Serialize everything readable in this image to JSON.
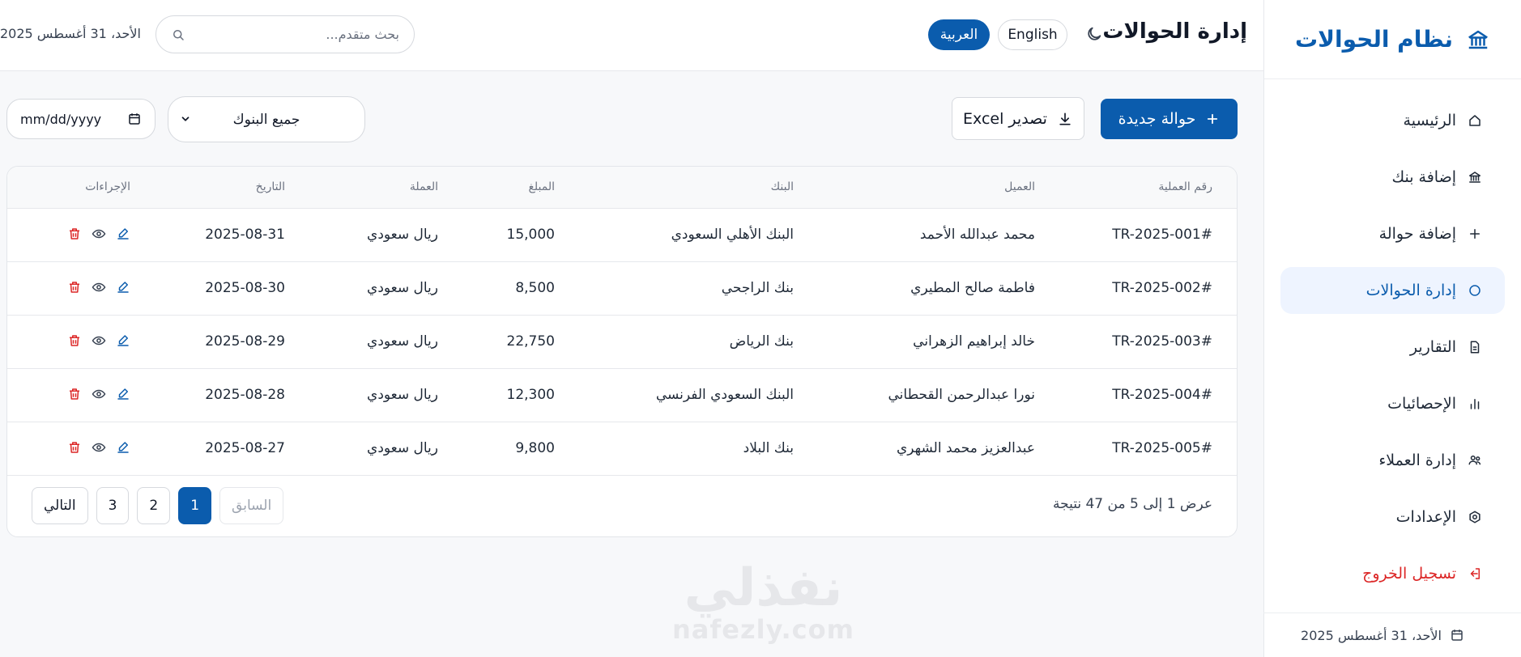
{
  "brand": {
    "title": "نظام الحوالات",
    "icon": "bank-icon"
  },
  "sidebar": {
    "items": [
      {
        "label": "الرئيسية",
        "icon": "home-icon"
      },
      {
        "label": "إضافة بنك",
        "icon": "bank-icon"
      },
      {
        "label": "إضافة حوالة",
        "icon": "plus-icon"
      },
      {
        "label": "إدارة الحوالات",
        "icon": "circle-icon",
        "active": true
      },
      {
        "label": "التقارير",
        "icon": "document-icon"
      },
      {
        "label": "الإحصائيات",
        "icon": "bar-chart-icon"
      },
      {
        "label": "إدارة العملاء",
        "icon": "users-icon"
      },
      {
        "label": "الإعدادات",
        "icon": "settings-icon"
      },
      {
        "label": "تسجيل الخروج",
        "icon": "logout-icon"
      }
    ],
    "footer_date": "الأحد، 31 أغسطس 2025"
  },
  "header": {
    "title": "إدارة الحوالات",
    "lang_en": "English",
    "lang_ar": "العربية",
    "search_placeholder": "بحث متقدم...",
    "date": "الأحد، 31 أغسطس 2025"
  },
  "toolbar": {
    "new_transfer": "حوالة جديدة",
    "export": "تصدير Excel",
    "bank_filter": "جميع البنوك",
    "date_placeholder": "mm/dd/yyyy"
  },
  "table": {
    "columns": [
      "رقم العملية",
      "العميل",
      "البنك",
      "المبلغ",
      "العملة",
      "التاريخ",
      "الإجراءات"
    ],
    "rows": [
      {
        "id": "#TR-2025-001",
        "client": "محمد عبدالله الأحمد",
        "bank": "البنك الأهلي السعودي",
        "amount": "15,000",
        "currency": "ريال سعودي",
        "date": "2025-08-31"
      },
      {
        "id": "#TR-2025-002",
        "client": "فاطمة صالح المطيري",
        "bank": "بنك الراجحي",
        "amount": "8,500",
        "currency": "ريال سعودي",
        "date": "2025-08-30"
      },
      {
        "id": "#TR-2025-003",
        "client": "خالد إبراهيم الزهراني",
        "bank": "بنك الرياض",
        "amount": "22,750",
        "currency": "ريال سعودي",
        "date": "2025-08-29"
      },
      {
        "id": "#TR-2025-004",
        "client": "نورا عبدالرحمن القحطاني",
        "bank": "البنك السعودي الفرنسي",
        "amount": "12,300",
        "currency": "ريال سعودي",
        "date": "2025-08-28"
      },
      {
        "id": "#TR-2025-005",
        "client": "عبدالعزيز محمد الشهري",
        "bank": "بنك البلاد",
        "amount": "9,800",
        "currency": "ريال سعودي",
        "date": "2025-08-27"
      }
    ],
    "results_text": "عرض 1 إلى 5 من 47 نتيجة",
    "pagination": {
      "prev": "السابق",
      "pages": [
        "1",
        "2",
        "3"
      ],
      "current": "1",
      "next": "التالي"
    }
  },
  "watermark": {
    "arabic": "نفذلي",
    "latin": "nafezly.com"
  },
  "colors": {
    "accent": "#0b5cad",
    "danger": "#dc2626",
    "active_bg": "#eef4ff"
  }
}
